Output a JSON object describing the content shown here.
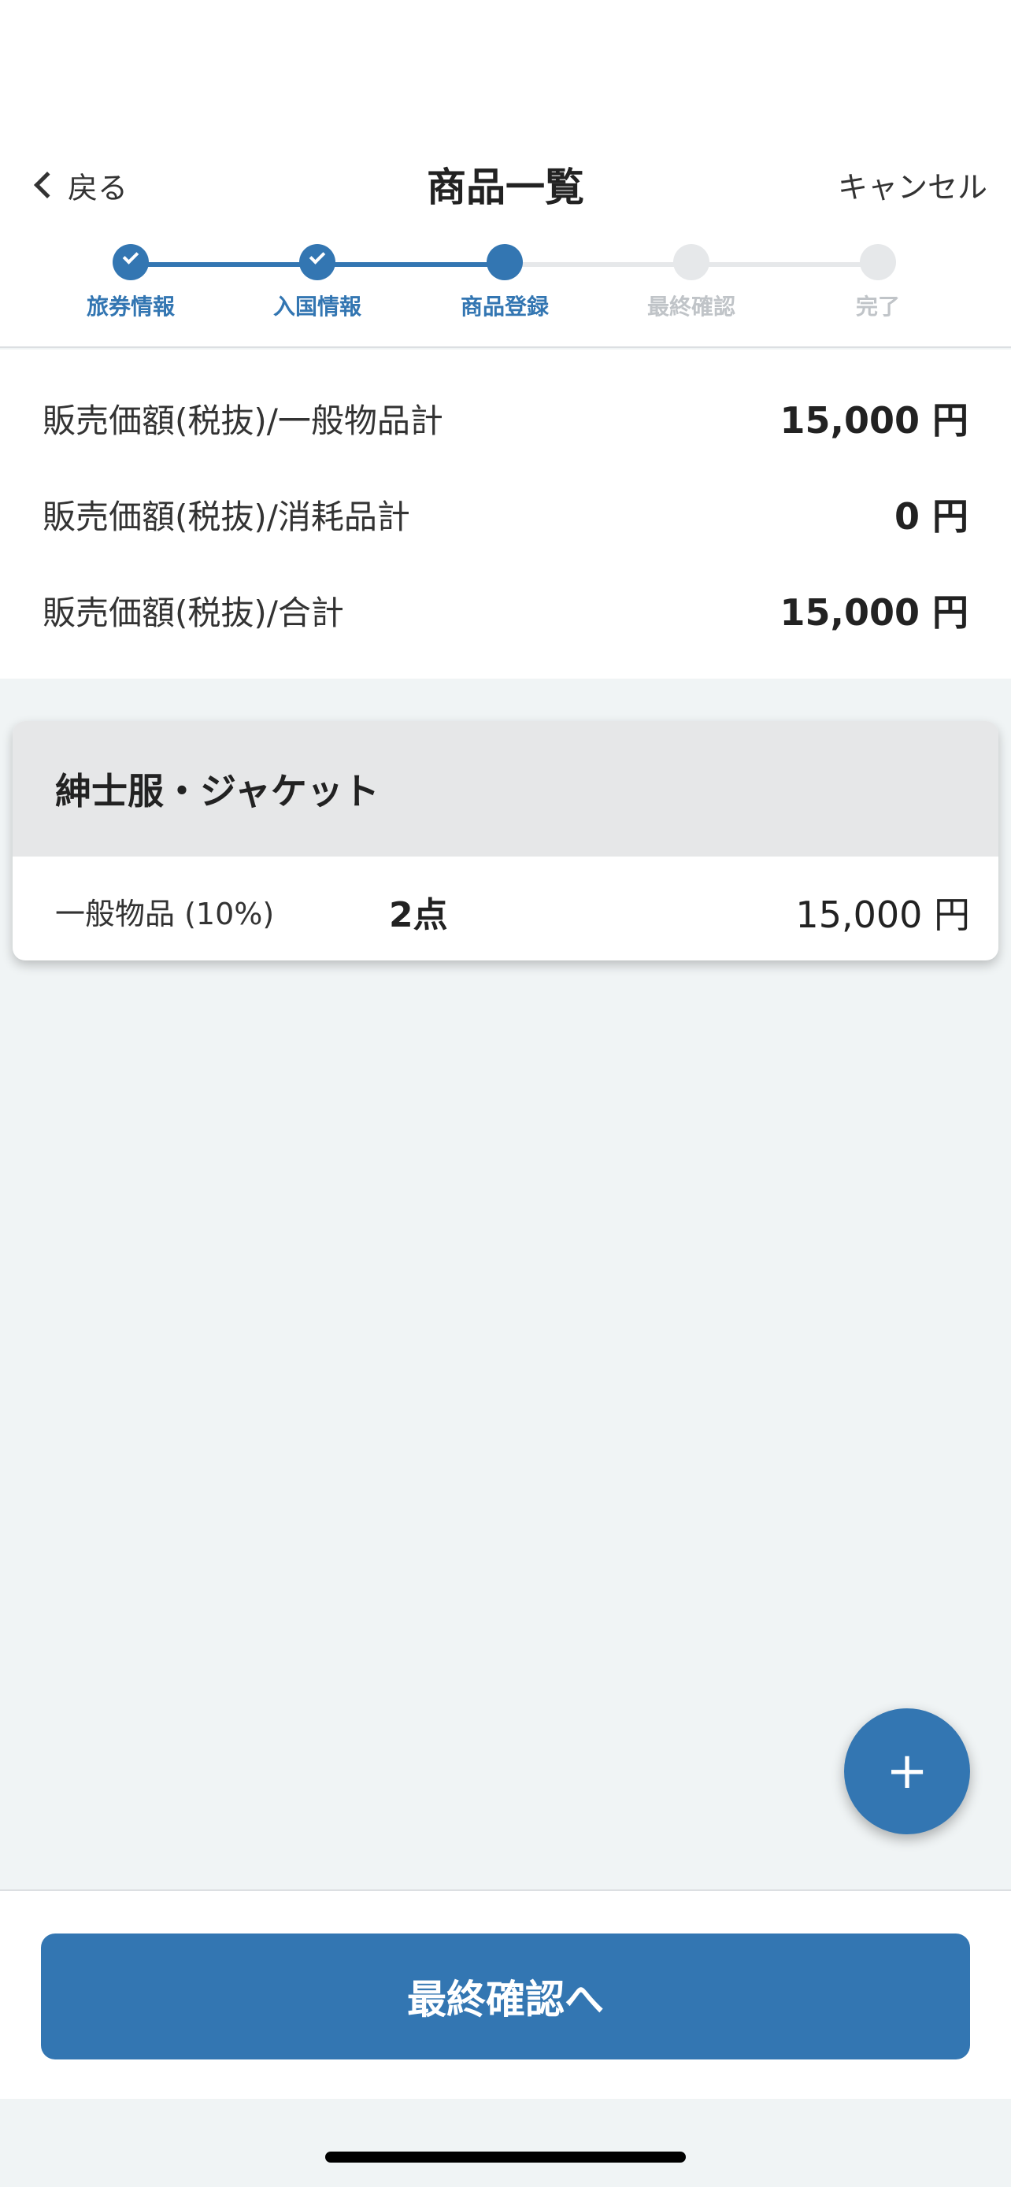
{
  "header": {
    "back_label": "戻る",
    "title": "商品一覧",
    "cancel_label": "キャンセル"
  },
  "stepper": {
    "steps": [
      {
        "label": "旅券情報",
        "state": "done"
      },
      {
        "label": "入国情報",
        "state": "done"
      },
      {
        "label": "商品登録",
        "state": "current"
      },
      {
        "label": "最終確認",
        "state": "pending"
      },
      {
        "label": "完了",
        "state": "pending"
      }
    ]
  },
  "totals": [
    {
      "label": "販売価額(税抜)/一般物品計",
      "value": "15,000 円"
    },
    {
      "label": "販売価額(税抜)/消耗品計",
      "value": "0 円"
    },
    {
      "label": "販売価額(税抜)/合計",
      "value": "15,000 円"
    }
  ],
  "products": [
    {
      "name": "紳士服・ジャケット",
      "category": "一般物品 (10%)",
      "quantity": "2点",
      "price": "15,000 円"
    }
  ],
  "fab": {
    "icon": "plus-icon",
    "glyph": "+"
  },
  "footer": {
    "primary_label": "最終確認へ"
  },
  "colors": {
    "accent": "#3376b2",
    "inactive": "#e6e8ea",
    "background": "#f0f4f5"
  }
}
